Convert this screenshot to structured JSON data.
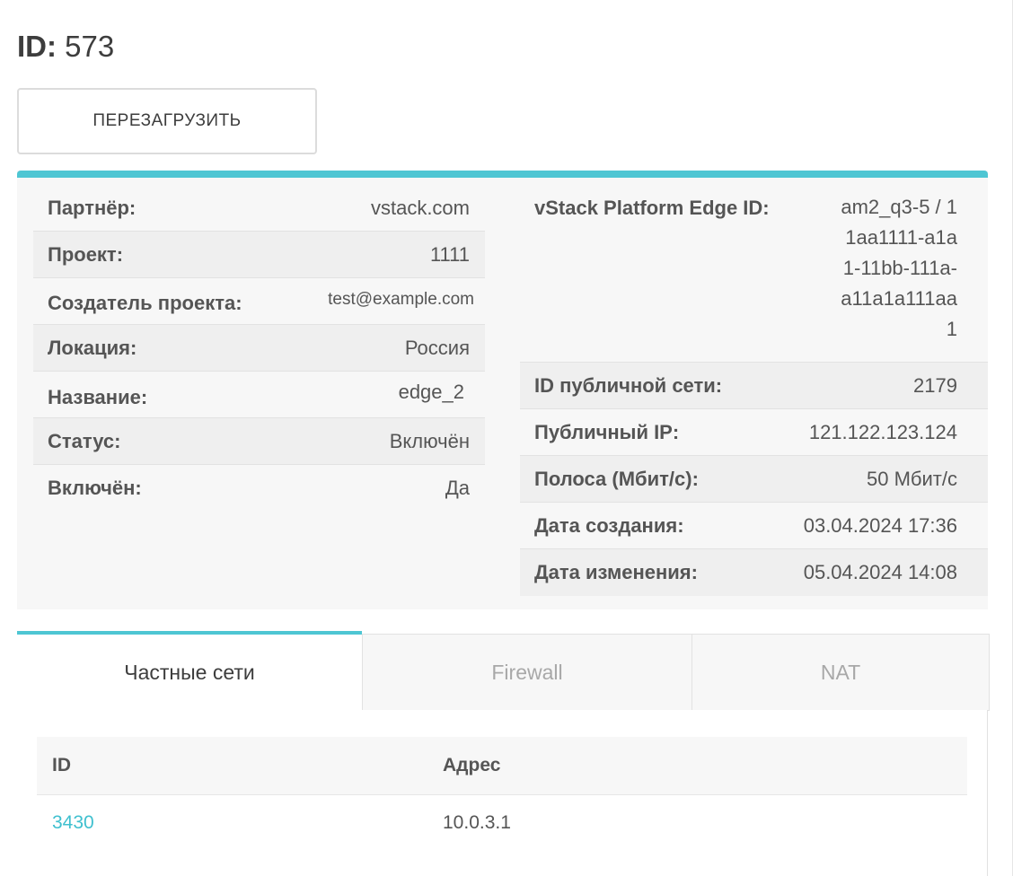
{
  "header": {
    "id_label": "ID:",
    "id_value": "573"
  },
  "actions": {
    "reload_label": "ПЕРЕЗАГРУЗИТЬ"
  },
  "colors": {
    "accent": "#4ec6d3",
    "link": "#3fc0cf"
  },
  "details_left": [
    {
      "label": "Партнёр:",
      "value": "vstack.com"
    },
    {
      "label": "Проект:",
      "value": "1111"
    },
    {
      "label": "Создатель проекта:",
      "value": "test@example.com"
    },
    {
      "label": "Локация:",
      "value": "Россия"
    },
    {
      "label": "Название:",
      "value": "edge_2"
    },
    {
      "label": "Статус:",
      "value": "Включён"
    },
    {
      "label": "Включён:",
      "value": "Да"
    }
  ],
  "details_right": [
    {
      "label": "vStack Platform Edge ID:",
      "value_lines": [
        "am2_q3-5 / 1",
        "1aa1111-a1a",
        "1-11bb-111a-",
        "a11a1a111aa",
        "1"
      ]
    },
    {
      "label": "ID публичной сети:",
      "value": "2179"
    },
    {
      "label": "Публичный IP:",
      "value": "121.122.123.124"
    },
    {
      "label": "Полоса (Мбит/с):",
      "value": "50 Мбит/с"
    },
    {
      "label": "Дата создания:",
      "value": "03.04.2024 17:36"
    },
    {
      "label": "Дата изменения:",
      "value": "05.04.2024 14:08"
    }
  ],
  "tabs": [
    {
      "label": "Частные сети",
      "active": true
    },
    {
      "label": "Firewall",
      "active": false
    },
    {
      "label": "NAT",
      "active": false
    }
  ],
  "private_networks": {
    "columns": [
      "ID",
      "Адрес"
    ],
    "rows": [
      {
        "id": "3430",
        "address": "10.0.3.1"
      }
    ]
  }
}
